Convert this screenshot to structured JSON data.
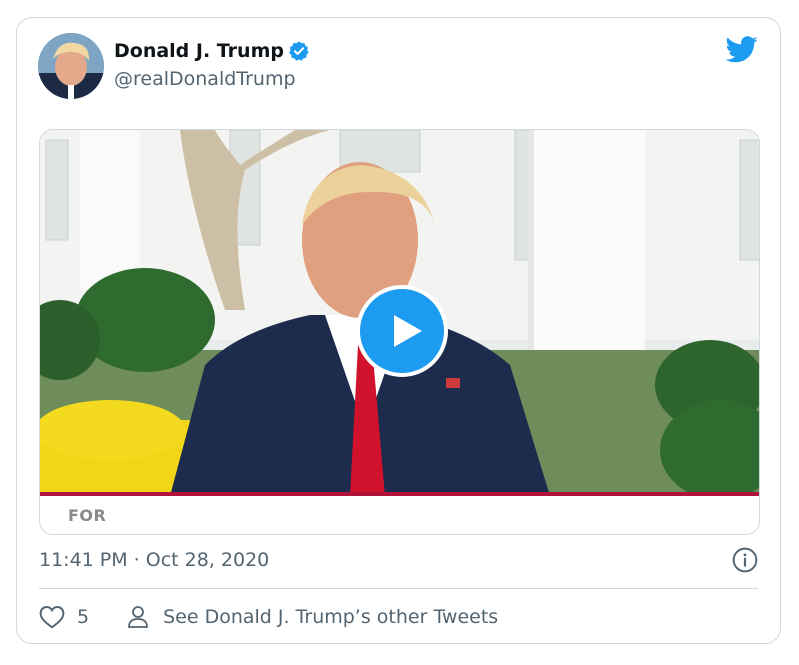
{
  "tweet": {
    "author_name": "Donald J. Trump",
    "handle": "@realDonaldTrump",
    "timestamp": "11:41 PM · Oct 28, 2020",
    "like_count": "5",
    "other_tweets_label": "See Donald J. Trump’s other Tweets"
  },
  "media": {
    "lower_third_text": "FOR"
  },
  "icons": {
    "verified": "verified-badge-icon",
    "brand": "twitter-bird-icon",
    "play": "play-icon",
    "info": "info-icon",
    "like": "heart-icon",
    "profile": "person-icon"
  },
  "colors": {
    "accent": "#1d9bf0",
    "text_primary": "#0f1419",
    "text_secondary": "#536471",
    "border": "#cfd9de",
    "video_bar": "#b0123a"
  }
}
